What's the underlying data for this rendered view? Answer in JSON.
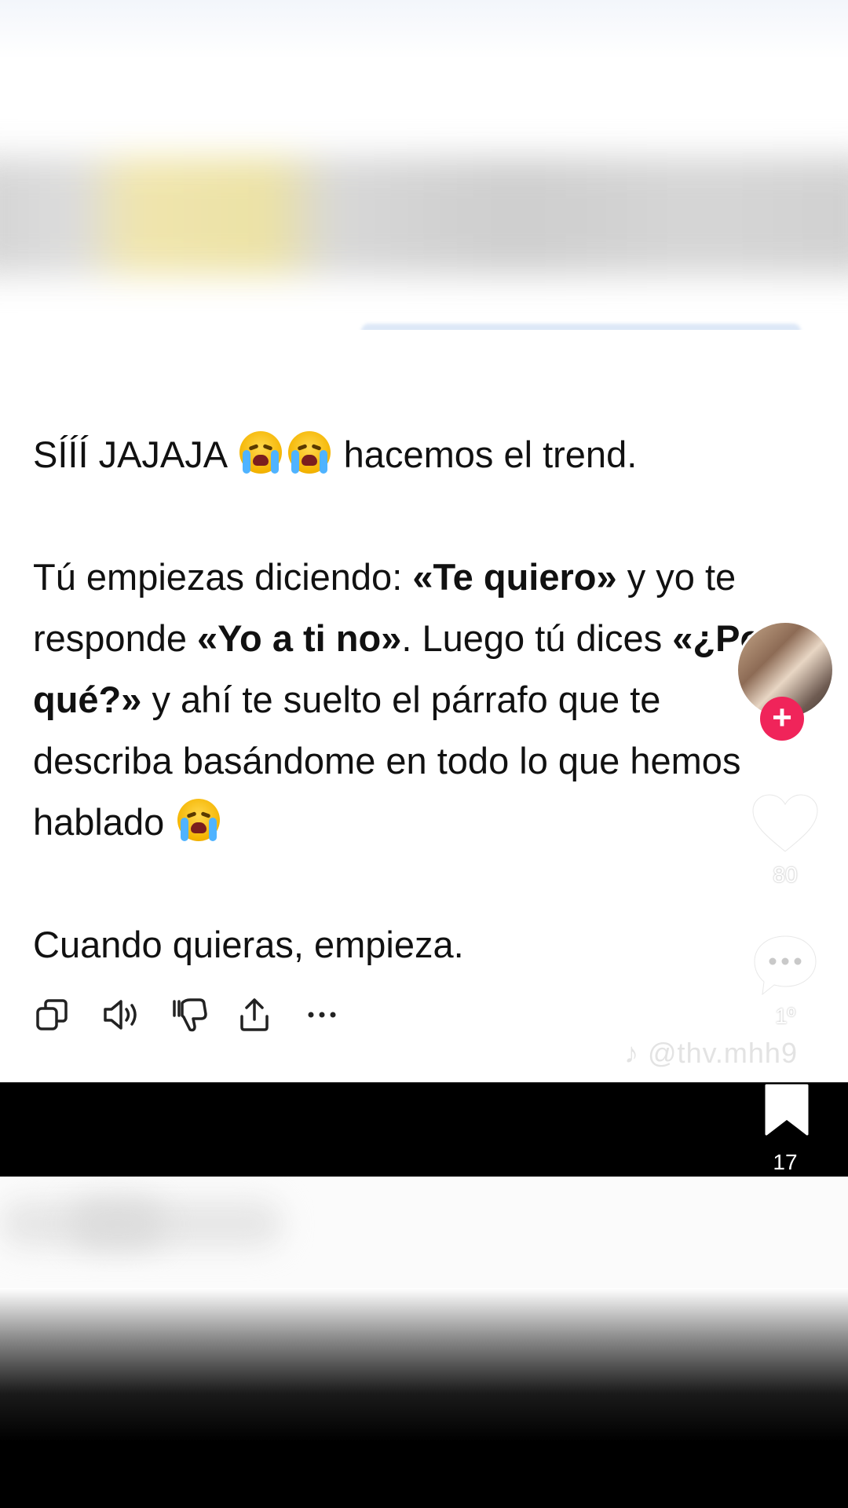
{
  "message": {
    "line1_prefix": "SÍÍÍ JAJAJA",
    "line1_suffix": "hacemos el trend.",
    "p2_part1": "Tú empiezas diciendo: ",
    "p2_bold1": "«Te quiero»",
    "p2_part2": " y yo te responde ",
    "p2_bold2": "«Yo a ti no»",
    "p2_part3": ". Luego tú dices ",
    "p2_bold3": "«¿Por qué?»",
    "p2_part4": " y ahí te suelto el párrafo que te describa basándome en todo lo que hemos hablado",
    "p3": "Cuando quieras, empieza."
  },
  "actions": [
    {
      "name": "copy-icon",
      "label": "copy"
    },
    {
      "name": "speaker-icon",
      "label": "read aloud"
    },
    {
      "name": "thumbs-down-icon",
      "label": "bad response"
    },
    {
      "name": "share-icon",
      "label": "share"
    },
    {
      "name": "more-icon",
      "label": "more"
    }
  ],
  "tiktok": {
    "likes": "80",
    "comments": "1º",
    "bookmarks": "17",
    "watermark": "@thv.mhh9",
    "follow_symbol": "+"
  },
  "colors": {
    "accent_follow": "#f0245a",
    "text": "#111111"
  }
}
